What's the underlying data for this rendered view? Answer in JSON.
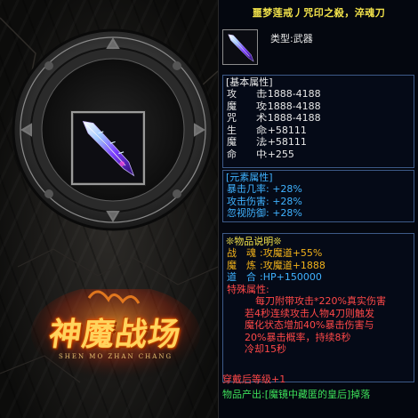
{
  "item": {
    "title": "噩梦莲戒丿咒印之殺，淬魂刀",
    "type": "类型:武器",
    "icon": "crystal-blade-icon"
  },
  "basic": {
    "header": "[基本属性]",
    "rows": [
      {
        "label": "攻　　击",
        "value": ":1888-4188"
      },
      {
        "label": "魔　　攻",
        "value": ":1888-4188"
      },
      {
        "label": "咒　　术",
        "value": ":1888-4188"
      },
      {
        "label": "生　　命",
        "value": ":+58111"
      },
      {
        "label": "魔　　法",
        "value": ":+58111"
      },
      {
        "label": "命　　中",
        "value": ":+255"
      }
    ]
  },
  "element": {
    "header": "[元素属性]",
    "rows": [
      "暴击几率: +28%",
      "攻击伤害: +28%",
      "忽视防御: +28%"
    ]
  },
  "desc": {
    "header": "❊物品说明❊",
    "stats": [
      {
        "label": "战　魂",
        "value": ":攻魔道+55%",
        "cls": "r-orange"
      },
      {
        "label": "魔　炼",
        "value": ":攻魔道+1888",
        "cls": "r-orange"
      },
      {
        "label": "道　合",
        "value": ":HP+150000",
        "cls": "r-blue"
      }
    ],
    "special_header": "特殊属性:",
    "special_lines": [
      "每刀附带攻击*220%真实伤害",
      "若4秒连续攻击人物4刀则触发",
      "魔化状态增加40%暴击伤害与",
      "20%暴击概率，持续8秒",
      "冷却15秒"
    ],
    "wear": "穿戴后等级+1",
    "drop": "物品产出:[魔镜中藏匿的皇后]掉落"
  },
  "logo": {
    "title": "神魔战场",
    "subtitle": "SHEN MO ZHAN CHANG"
  },
  "colors": {
    "title": "#f2e24a",
    "element": "#3fb2ff",
    "special": "#ff4848",
    "drop": "#3de05a",
    "border": "#3d5a88"
  }
}
